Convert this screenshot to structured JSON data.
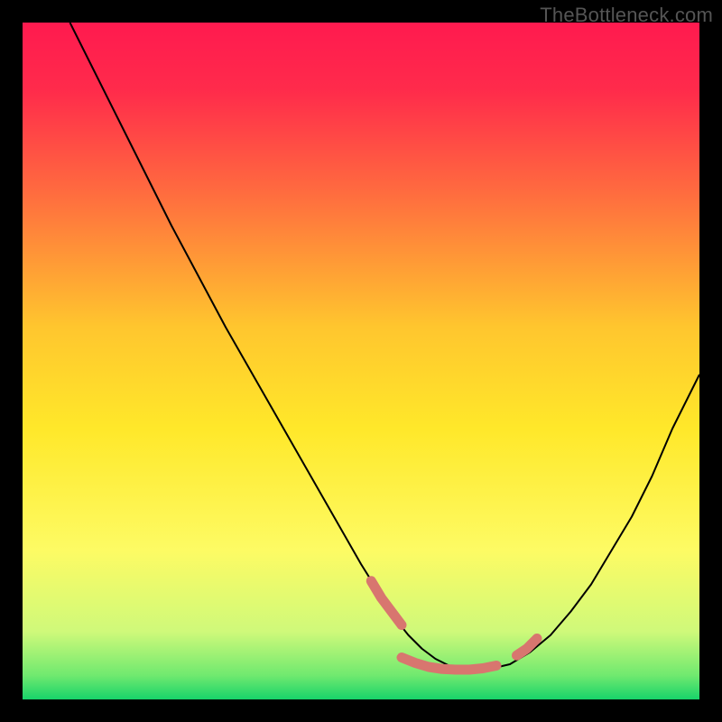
{
  "watermark": "TheBottleneck.com",
  "chart_data": {
    "type": "line",
    "title": "",
    "xlabel": "",
    "ylabel": "",
    "xlim": [
      0,
      100
    ],
    "ylim": [
      0,
      100
    ],
    "grid": false,
    "background_gradient": {
      "stops": [
        {
          "pos": 0.0,
          "color": "#ff1a4f"
        },
        {
          "pos": 0.1,
          "color": "#ff2b4b"
        },
        {
          "pos": 0.25,
          "color": "#ff6b3f"
        },
        {
          "pos": 0.45,
          "color": "#ffc62e"
        },
        {
          "pos": 0.6,
          "color": "#ffe82a"
        },
        {
          "pos": 0.78,
          "color": "#fdfb64"
        },
        {
          "pos": 0.9,
          "color": "#cff97a"
        },
        {
          "pos": 0.965,
          "color": "#6fe96f"
        },
        {
          "pos": 1.0,
          "color": "#17d36a"
        }
      ]
    },
    "series": [
      {
        "name": "curve",
        "color": "#000000",
        "stroke_width": 2,
        "x": [
          7,
          10,
          14,
          18,
          22,
          26,
          30,
          34,
          38,
          42,
          46,
          50,
          52.5,
          55,
          57,
          59,
          61,
          63,
          65,
          67,
          69,
          72,
          75,
          78,
          81,
          84,
          87,
          90,
          93,
          96,
          100
        ],
        "y": [
          100,
          94,
          86,
          78,
          70,
          62.5,
          55,
          48,
          41,
          34,
          27,
          20,
          16,
          12,
          9.5,
          7.5,
          6,
          5,
          4.5,
          4.3,
          4.5,
          5.2,
          7,
          9.5,
          13,
          17,
          22,
          27,
          33,
          40,
          48
        ]
      },
      {
        "name": "highlight-left",
        "color": "#d8766f",
        "stroke_width": 11,
        "linecap": "round",
        "x": [
          51.5,
          53,
          54.5,
          56
        ],
        "y": [
          17.5,
          15,
          13,
          11
        ]
      },
      {
        "name": "highlight-bottom",
        "color": "#d8766f",
        "stroke_width": 11,
        "linecap": "round",
        "x": [
          56,
          58,
          60,
          62,
          64,
          66,
          68,
          70
        ],
        "y": [
          6.2,
          5.4,
          4.8,
          4.5,
          4.4,
          4.4,
          4.6,
          5.0
        ]
      },
      {
        "name": "highlight-right",
        "color": "#d8766f",
        "stroke_width": 11,
        "linecap": "round",
        "x": [
          73,
          74.5,
          76
        ],
        "y": [
          6.5,
          7.5,
          9
        ]
      }
    ]
  }
}
